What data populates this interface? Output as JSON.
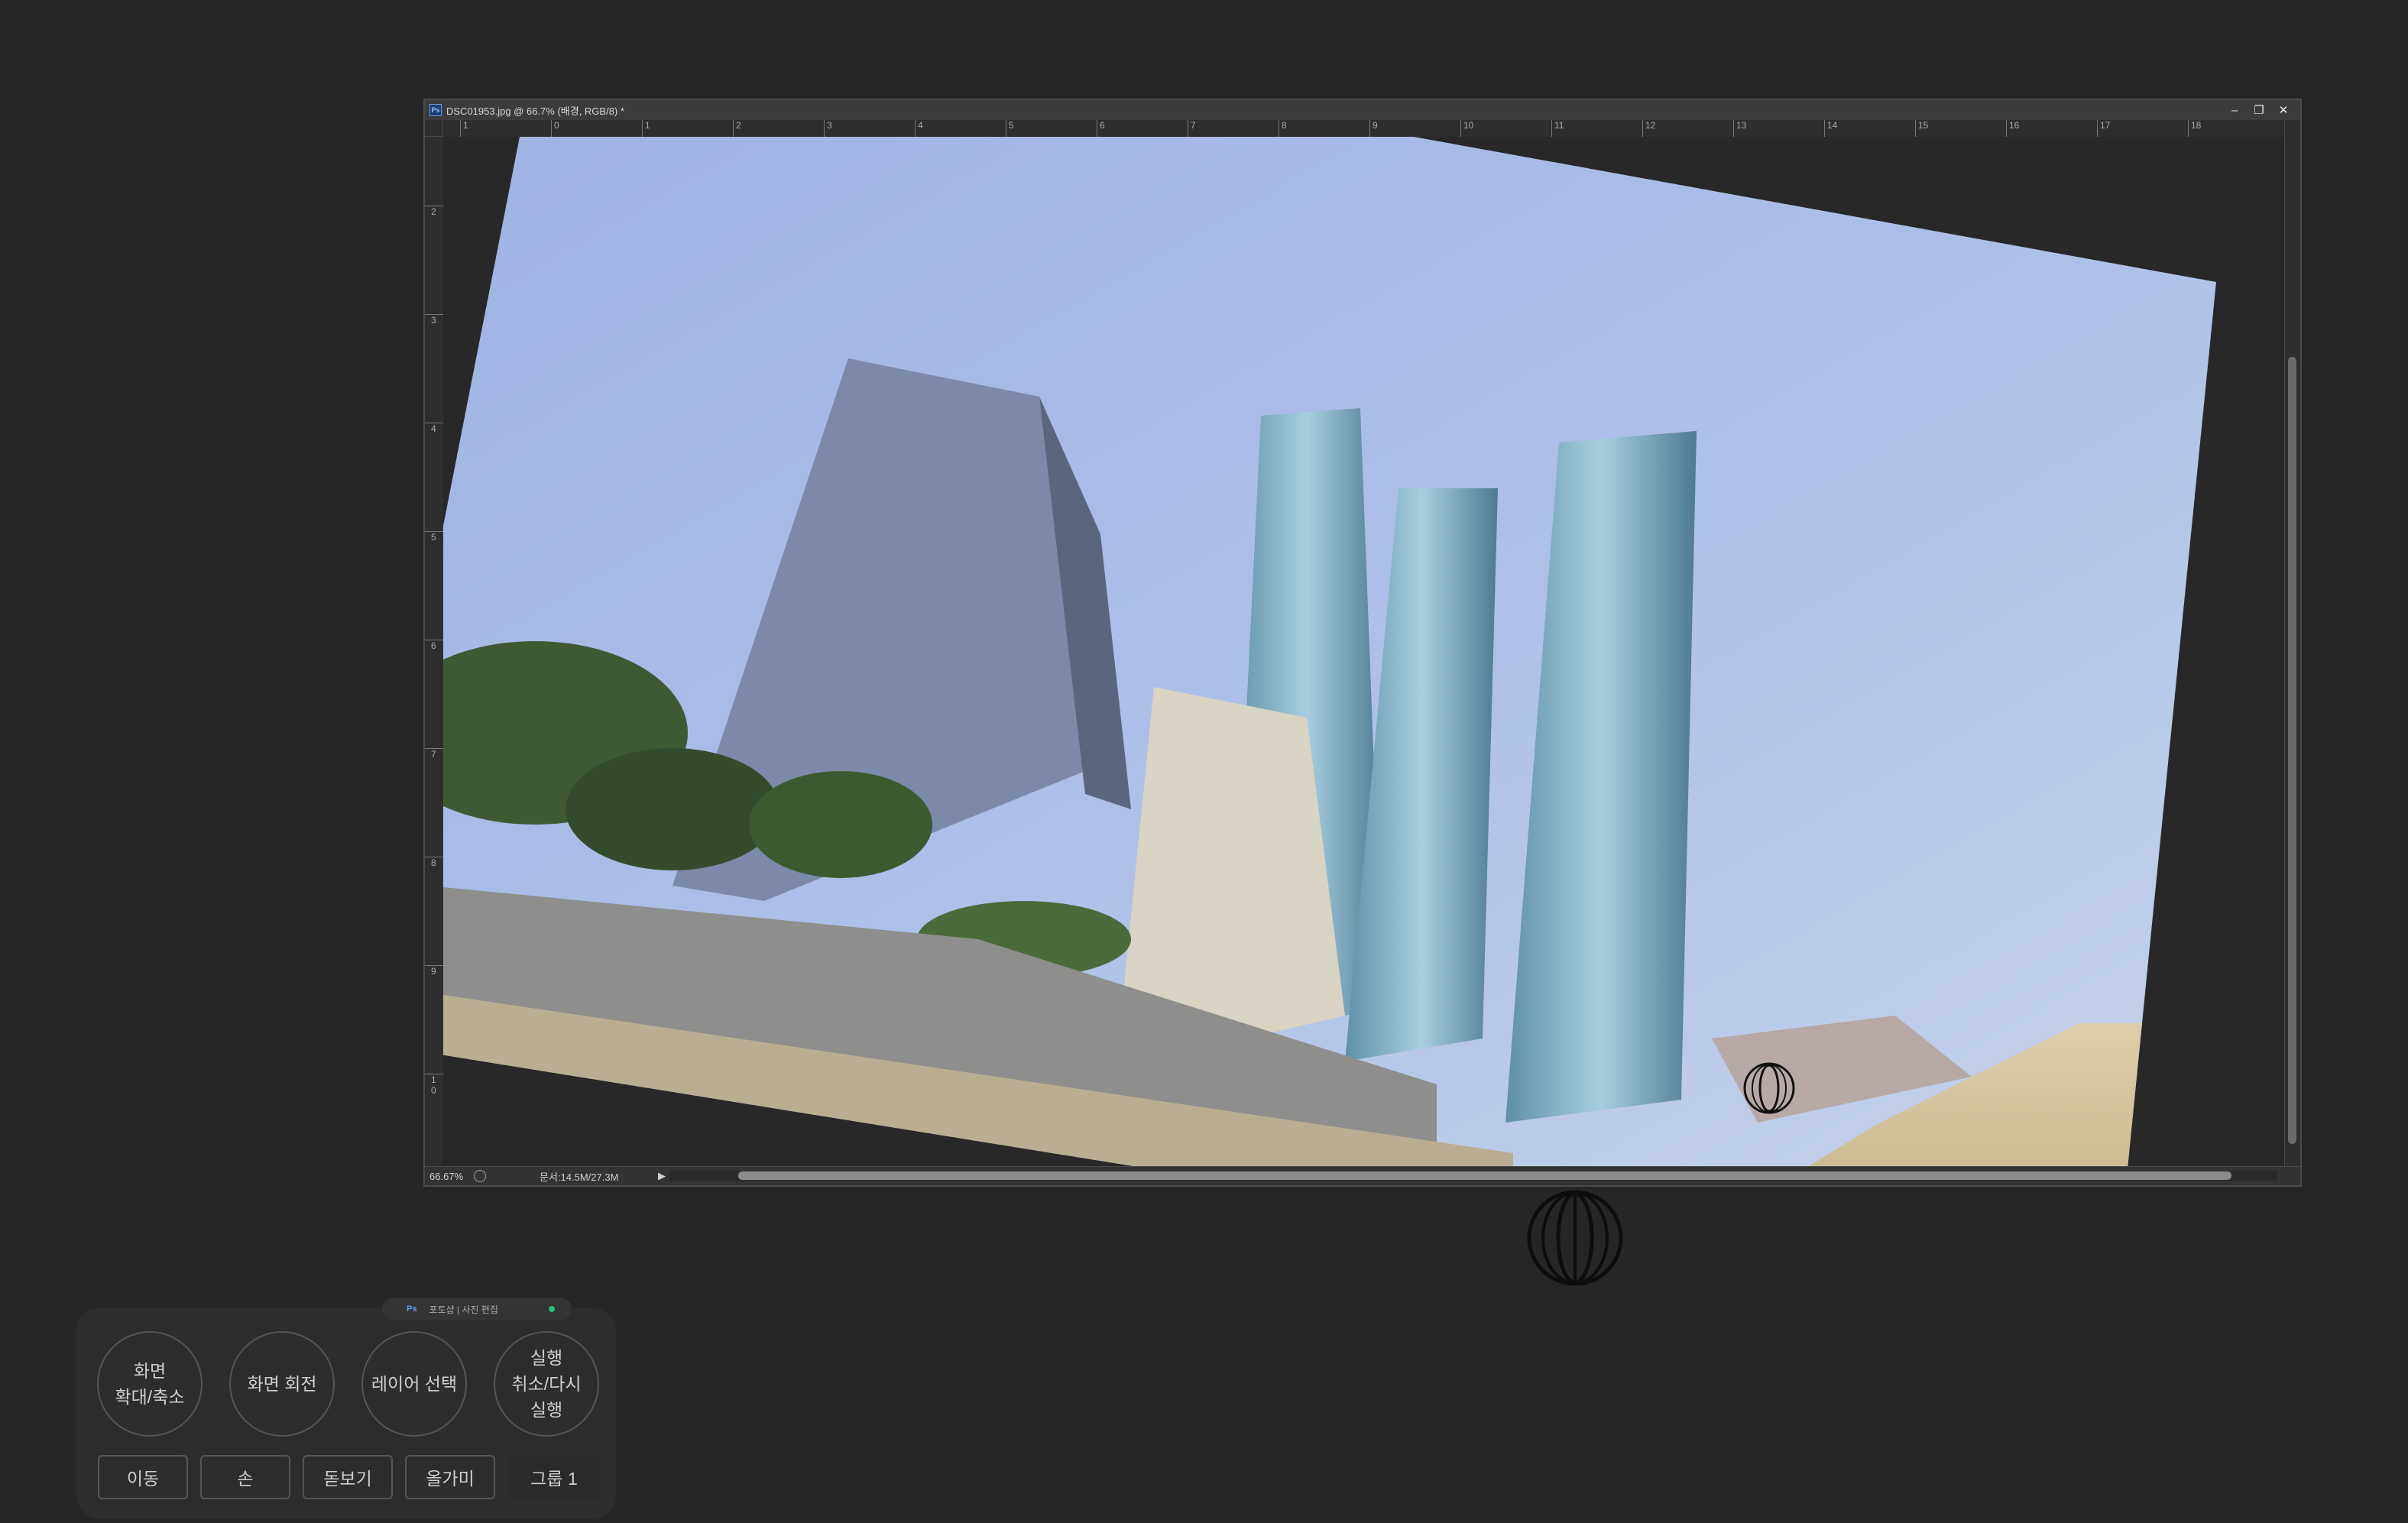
{
  "document": {
    "title": "DSC01953.jpg @ 66.7% (배경, RGB/8) *",
    "ruler_h": [
      "1",
      "0",
      "1",
      "2",
      "3",
      "4",
      "5",
      "6",
      "7",
      "8",
      "9",
      "10",
      "11",
      "12",
      "13",
      "14",
      "15",
      "16",
      "17",
      "18"
    ],
    "ruler_v": [
      "2",
      "3",
      "4",
      "5",
      "6",
      "7",
      "8",
      "9",
      "1\n0"
    ],
    "status_zoom": "66.67%",
    "status_info": "문서:14.5M/27.3M"
  },
  "window_controls": {
    "minimize": "–",
    "restore": "❐",
    "close": "✕"
  },
  "palette": {
    "tab_app": "Ps",
    "tab_label": "포토샵 | 사진 편집",
    "circle_buttons": [
      "화면\n확대/축소",
      "화면 회전",
      "레이어 선택",
      "실행\n취소/다시\n실행"
    ],
    "rect_buttons": [
      "이동",
      "손",
      "돋보기",
      "올가미"
    ],
    "group_label": "그룹 1"
  },
  "colors": {
    "background": "#262626",
    "sky": "#a9bde6",
    "sand": "#d8c9a2"
  },
  "icons": [
    "photoshop-badge-icon",
    "minimize-icon",
    "restore-icon",
    "close-icon",
    "rotate-view-cursor-icon"
  ]
}
